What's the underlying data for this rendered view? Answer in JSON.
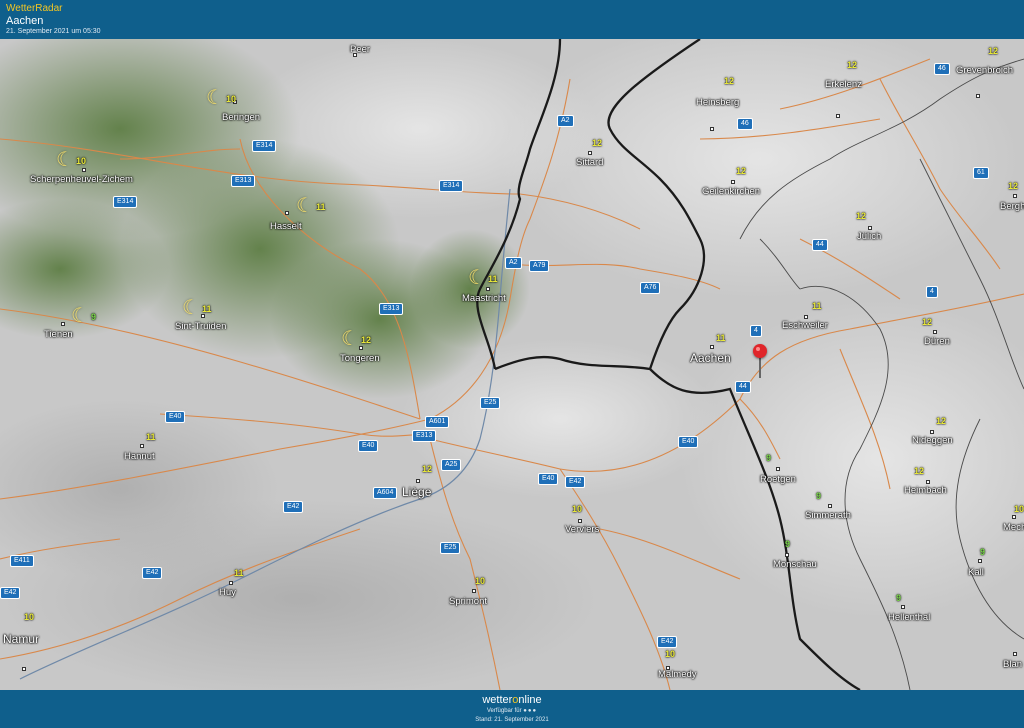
{
  "header": {
    "brand": "WetterRadar",
    "location": "Aachen",
    "timestamp": "21. September 2021 um 05:30"
  },
  "colors": {
    "header_bg": "#0f5f8c",
    "brand_accent": "#f3c623",
    "road": "#d9884a",
    "border": "#1a1a1a",
    "temp_green": "#7cd94c",
    "temp_yellow": "#e8e83a",
    "pin": "#e0262b",
    "radar_green": "#5e7e45"
  },
  "map": {
    "cities": [
      {
        "name": "Peer",
        "temp": ""
      },
      {
        "name": "Beringen",
        "temp": "10",
        "night": true
      },
      {
        "name": "Scherpenheuvel-Zichem",
        "temp": "10",
        "night": true
      },
      {
        "name": "Hasselt",
        "temp": "11",
        "night": true
      },
      {
        "name": "Tienen",
        "temp": "9",
        "night": true
      },
      {
        "name": "Sint-Truiden",
        "temp": "11",
        "night": true
      },
      {
        "name": "Tongeren",
        "temp": "12",
        "night": true
      },
      {
        "name": "Maastricht",
        "temp": "11",
        "night": true
      },
      {
        "name": "Sittard",
        "temp": "12"
      },
      {
        "name": "Heinsberg",
        "temp": "12"
      },
      {
        "name": "Erkelenz",
        "temp": "12"
      },
      {
        "name": "Grevenbroich",
        "temp": "12"
      },
      {
        "name": "Geilenkirchen",
        "temp": "12"
      },
      {
        "name": "Jülich",
        "temp": "12"
      },
      {
        "name": "Bergh",
        "temp": "12"
      },
      {
        "name": "Eschweiler",
        "temp": "11"
      },
      {
        "name": "Aachen",
        "temp": "11"
      },
      {
        "name": "Düren",
        "temp": "12"
      },
      {
        "name": "Hannut",
        "temp": "11"
      },
      {
        "name": "Liège",
        "temp": "12"
      },
      {
        "name": "Nideggen",
        "temp": "12"
      },
      {
        "name": "Roetgen",
        "temp": "9"
      },
      {
        "name": "Heimbach",
        "temp": "12"
      },
      {
        "name": "Simmerath",
        "temp": "9"
      },
      {
        "name": "Verviers",
        "temp": "10"
      },
      {
        "name": "Monschau",
        "temp": "9"
      },
      {
        "name": "Kall",
        "temp": "9"
      },
      {
        "name": "Mech",
        "temp": "10"
      },
      {
        "name": "Huy",
        "temp": "11"
      },
      {
        "name": "Sprimont",
        "temp": "10"
      },
      {
        "name": "Namur",
        "temp": "10"
      },
      {
        "name": "Hellenthal",
        "temp": "9"
      },
      {
        "name": "Malmedy",
        "temp": "10"
      },
      {
        "name": "Blan",
        "temp": ""
      }
    ],
    "road_labels": [
      "A2",
      "E314",
      "E313",
      "E314",
      "E314",
      "A2",
      "A79",
      "A76",
      "E313",
      "46",
      "46",
      "61",
      "44",
      "4",
      "4",
      "44",
      "E40",
      "A601",
      "E25",
      "E40",
      "E313",
      "A25",
      "E40",
      "E42",
      "E40",
      "A604",
      "E42",
      "E411",
      "E42",
      "E42",
      "E25",
      "E42"
    ],
    "pin_label": "Aachen"
  },
  "footer": {
    "logo_part1": "wetter",
    "logo_part2": "o",
    "logo_part3": "nline",
    "availability": "Verfügbar für",
    "availability_dots": "●●●",
    "stand": "Stand: 21. September 2021"
  }
}
